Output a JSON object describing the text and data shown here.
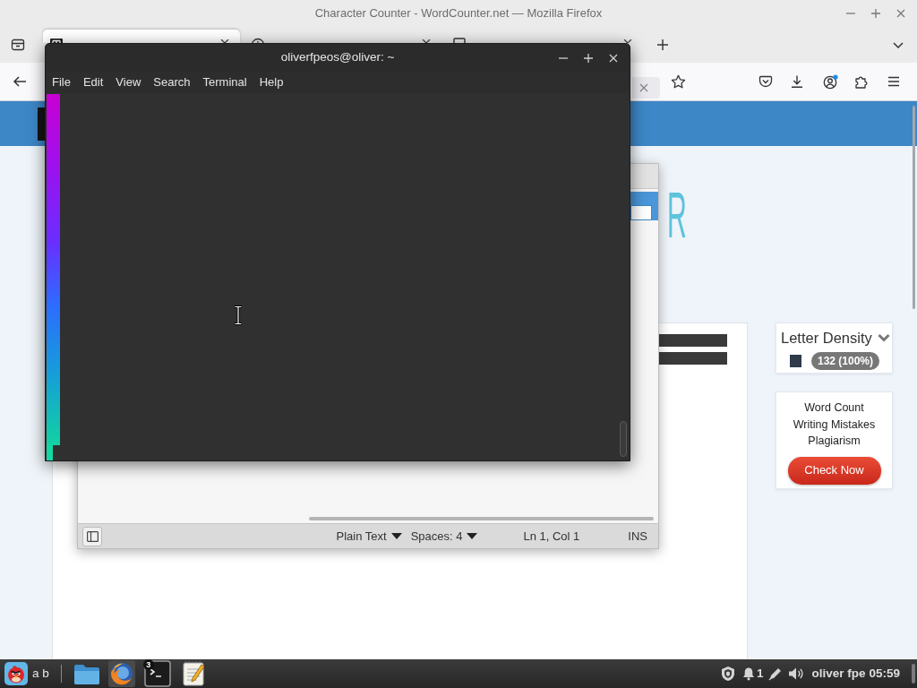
{
  "firefox": {
    "title": "Character Counter - WordCounter.net — Mozilla Firefox",
    "tabs": [
      {
        "selected": true
      },
      {
        "selected": false
      },
      {
        "selected": false
      }
    ]
  },
  "page": {
    "logo_text": "R",
    "letter_density": {
      "title": "Letter Density",
      "count": "132 (100%)"
    },
    "promo": {
      "lines": [
        "Word Count",
        "Writing Mistakes",
        "Plagiarism"
      ],
      "button": "Check Now"
    }
  },
  "text_editor": {
    "status_bar": {
      "language": "Plain Text",
      "indentation": "Spaces: 4",
      "position": "Ln 1, Col 1",
      "mode": "INS"
    }
  },
  "terminal": {
    "title": "oliverfpeos@oliver: ~",
    "menu": [
      "File",
      "Edit",
      "View",
      "Search",
      "Terminal",
      "Help"
    ]
  },
  "taskbar": {
    "launcher_label": "a b",
    "terminal_badge": "3",
    "notification_count": "1",
    "user": "oliver fpe",
    "clock": "05:59"
  }
}
